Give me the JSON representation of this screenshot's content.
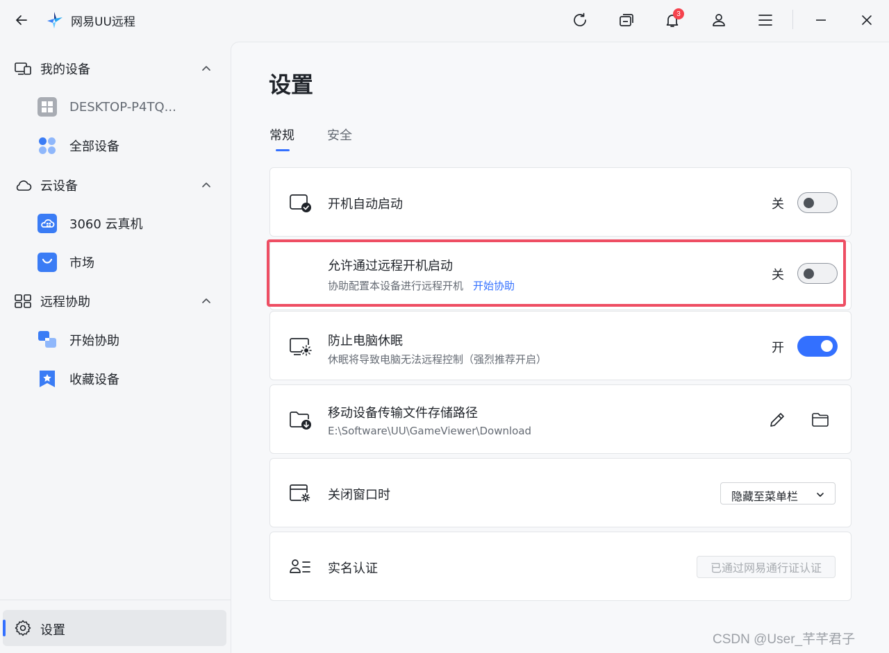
{
  "app": {
    "title": "网易UU远程",
    "notification_count": "3"
  },
  "sidebar": {
    "groups": [
      {
        "label": "我的设备",
        "items": [
          {
            "label": "DESKTOP-P4TQ..."
          },
          {
            "label": "全部设备"
          }
        ]
      },
      {
        "label": "云设备",
        "items": [
          {
            "label": "3060 云真机"
          },
          {
            "label": "市场"
          }
        ]
      },
      {
        "label": "远程协助",
        "items": [
          {
            "label": "开始协助"
          },
          {
            "label": "收藏设备"
          }
        ]
      }
    ],
    "settings_label": "设置"
  },
  "main": {
    "title": "设置",
    "tabs": [
      {
        "label": "常规",
        "active": true
      },
      {
        "label": "安全",
        "active": false
      }
    ],
    "rows": [
      {
        "title": "开机自动启动",
        "state": "关",
        "on": false
      },
      {
        "title": "允许通过远程开机启动",
        "subtitle": "协助配置本设备进行远程开机",
        "link": "开始协助",
        "state": "关",
        "on": false
      },
      {
        "title": "防止电脑休眠",
        "subtitle": "休眠将导致电脑无法远程控制（强烈推荐开启）",
        "state": "开",
        "on": true
      },
      {
        "title": "移动设备传输文件存储路径",
        "subtitle": "E:\\Software\\UU\\GameViewer\\Download"
      },
      {
        "title": "关闭窗口时",
        "select_value": "隐藏至菜单栏"
      },
      {
        "title": "实名认证",
        "status": "已通过网易通行证认证"
      }
    ]
  },
  "watermark": "CSDN @User_芊芊君子",
  "colors": {
    "accent": "#3370ff",
    "highlight": "#ee4e63",
    "badge": "#f5424d"
  }
}
